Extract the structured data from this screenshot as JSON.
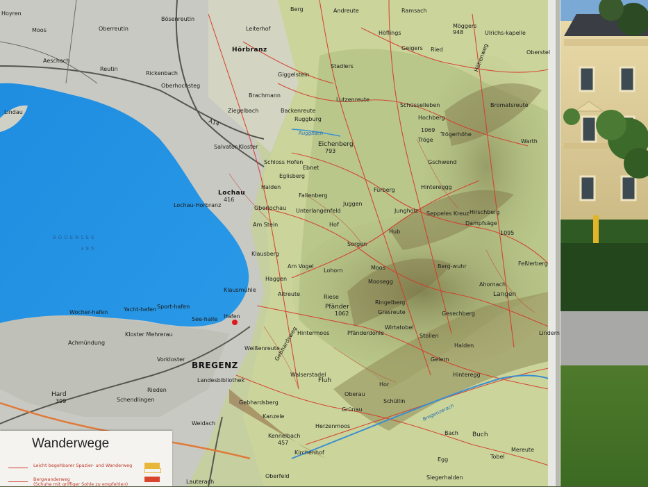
{
  "legend": {
    "title": "Wanderwege",
    "rows": [
      {
        "text": "Leicht begehbarer Spazier- und Wanderweg",
        "swatch": "#e8b73a"
      },
      {
        "text": "Bergwanderweg",
        "subtext": "(Schuhe mit griffiger Sohle zu empfehlen)",
        "swatch": "#d9452c"
      }
    ]
  },
  "lake": {
    "name": "BODENSEE",
    "elevation": "395"
  },
  "river": {
    "name": "Ruggbach"
  },
  "places": [
    {
      "name": "Hoyren"
    },
    {
      "name": "Moos"
    },
    {
      "name": "Oberreutin"
    },
    {
      "name": "Bösenreutin"
    },
    {
      "name": "Aeschach"
    },
    {
      "name": "Reutin"
    },
    {
      "name": "Lindau"
    },
    {
      "name": "Rickenbach"
    },
    {
      "name": "Oberhochsteg"
    },
    {
      "name": "Hörbranz"
    },
    {
      "name": "Leiterhof"
    },
    {
      "name": "Berg"
    },
    {
      "name": "Andreute"
    },
    {
      "name": "Ramsach"
    },
    {
      "name": "Höflings"
    },
    {
      "name": "Möggers"
    },
    {
      "name": "948"
    },
    {
      "name": "Ulrichs-kapelle"
    },
    {
      "name": "Geigers"
    },
    {
      "name": "Ried"
    },
    {
      "name": "Giggelstein"
    },
    {
      "name": "Stadlers"
    },
    {
      "name": "Oberstel"
    },
    {
      "name": "Brachmann"
    },
    {
      "name": "Ziegelbach"
    },
    {
      "name": "Backenreute"
    },
    {
      "name": "Lutzenreute"
    },
    {
      "name": "Schüsselleben"
    },
    {
      "name": "Bromatsreute"
    },
    {
      "name": "Hochberg"
    },
    {
      "name": "1069"
    },
    {
      "name": "Tröge"
    },
    {
      "name": "Trögerhöhe"
    },
    {
      "name": "Ruggburg"
    },
    {
      "name": "Eichenberg"
    },
    {
      "name": "793"
    },
    {
      "name": "Salvator-Kloster"
    },
    {
      "name": "Schloss Hofen"
    },
    {
      "name": "Ebnet"
    },
    {
      "name": "Gschwend"
    },
    {
      "name": "Warth"
    },
    {
      "name": "Lochau"
    },
    {
      "name": "416"
    },
    {
      "name": "Lochau-Horbranz"
    },
    {
      "name": "Halden"
    },
    {
      "name": "Eglisberg"
    },
    {
      "name": "Fallenberg"
    },
    {
      "name": "Fürberg"
    },
    {
      "name": "Hintereggg"
    },
    {
      "name": "Unterlangenfeld"
    },
    {
      "name": "Juggen"
    },
    {
      "name": "Oberlochau"
    },
    {
      "name": "Hof"
    },
    {
      "name": "Jungholz"
    },
    {
      "name": "Seppeles Kreuz"
    },
    {
      "name": "Hirschberg"
    },
    {
      "name": "Dampfsäge"
    },
    {
      "name": "1095"
    },
    {
      "name": "Am Stein"
    },
    {
      "name": "Hub"
    },
    {
      "name": "Sorgen"
    },
    {
      "name": "Klausberg"
    },
    {
      "name": "Am Vogel"
    },
    {
      "name": "Lohorn"
    },
    {
      "name": "Moos"
    },
    {
      "name": "Berg-wuhr"
    },
    {
      "name": "Feßlerberg"
    },
    {
      "name": "Haggen"
    },
    {
      "name": "Moosegg"
    },
    {
      "name": "Ahornach"
    },
    {
      "name": "Klausmühle"
    },
    {
      "name": "Altreute"
    },
    {
      "name": "Riese"
    },
    {
      "name": "Pfänder"
    },
    {
      "name": "1062"
    },
    {
      "name": "Ringelberg"
    },
    {
      "name": "Langen"
    },
    {
      "name": "Grasreute"
    },
    {
      "name": "Gesechberg"
    },
    {
      "name": "Wirtatobel"
    },
    {
      "name": "Hafen"
    },
    {
      "name": "Hintermoos"
    },
    {
      "name": "Pfänderdohle"
    },
    {
      "name": "Stollen"
    },
    {
      "name": "Halden"
    },
    {
      "name": "Lindern"
    },
    {
      "name": "Weißenreute"
    },
    {
      "name": "Gelern"
    },
    {
      "name": "BREGENZ"
    },
    {
      "name": "Walserstadel"
    },
    {
      "name": "Fluh"
    },
    {
      "name": "Hor"
    },
    {
      "name": "Hinteregg"
    },
    {
      "name": "Oberau"
    },
    {
      "name": "Schüllin"
    },
    {
      "name": "Gebhardsberg"
    },
    {
      "name": "Grünau"
    },
    {
      "name": "Kanzele"
    },
    {
      "name": "Herzenmoos"
    },
    {
      "name": "Bach"
    },
    {
      "name": "Buch"
    },
    {
      "name": "Kennelbach"
    },
    {
      "name": "457"
    },
    {
      "name": "Weidach"
    },
    {
      "name": "Kloster Mehrerau"
    },
    {
      "name": "Vorkloster"
    },
    {
      "name": "Hard"
    },
    {
      "name": "399"
    },
    {
      "name": "Schendlingen"
    },
    {
      "name": "Rieden"
    },
    {
      "name": "Achmündung"
    },
    {
      "name": "Yacht-hafen"
    },
    {
      "name": "Sport-hafen"
    },
    {
      "name": "See-halle"
    },
    {
      "name": "Wocher-hafen"
    },
    {
      "name": "Landesbibliothek"
    },
    {
      "name": "Kirchenhof"
    },
    {
      "name": "Lauterach"
    },
    {
      "name": "Oberfeld"
    },
    {
      "name": "Egg"
    },
    {
      "name": "Siegerhalden"
    },
    {
      "name": "Mereute"
    },
    {
      "name": "Tobel"
    },
    {
      "name": "Höhenweg"
    },
    {
      "name": "Bregenzerach"
    },
    {
      "name": "Gebhardsweg"
    },
    {
      "name": "A14"
    }
  ]
}
